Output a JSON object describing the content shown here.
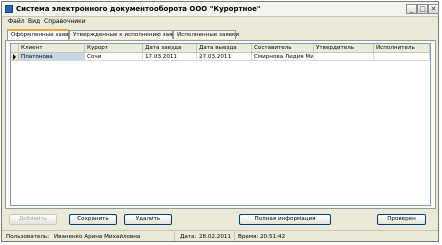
{
  "window": {
    "title": "Система электронного документооборота ООО \"Курортное\""
  },
  "menu": {
    "items": [
      "Файл",
      "Вид",
      "Справочники"
    ]
  },
  "tabs": [
    {
      "label": "Оформленные заявки",
      "active": true
    },
    {
      "label": "Утвержденные к исполнению заявки",
      "active": false
    },
    {
      "label": "Исполненные заявки",
      "active": false
    }
  ],
  "table": {
    "columns": [
      "Клиент",
      "Курорт",
      "Дата заезда",
      "Дата выезда",
      "Составитель",
      "Утвердитель",
      "Исполнитель"
    ],
    "rows": [
      [
        "Платонова",
        "Сочи",
        "17.03.2011",
        "27.03.2011",
        "Смирнова Лидия Михай",
        "",
        ""
      ]
    ]
  },
  "buttons": {
    "add": "Добавить",
    "save": "Сохранить",
    "delete": "Удалить",
    "full_info": "Полная информация",
    "check": "Проверен"
  },
  "status": {
    "user_label": "Пользователь:",
    "user_value": "Иваненко Арина Михайловна",
    "date_label": "Дата:",
    "date_value": "28.02.2011",
    "time_label": "Время:",
    "time_value": "20:51:42"
  }
}
